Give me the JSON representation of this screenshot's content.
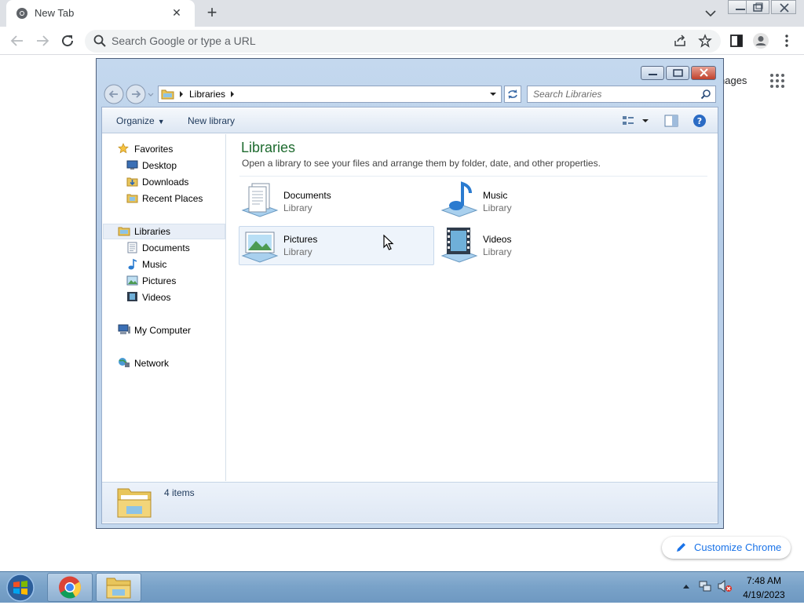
{
  "browser": {
    "tab_title": "New Tab",
    "omnibox_placeholder": "Search Google or type a URL",
    "ntp_images_link": "nages",
    "customize_chrome": "Customize Chrome"
  },
  "explorer": {
    "address_path": "Libraries",
    "search_placeholder": "Search Libraries",
    "toolbar": {
      "organize": "Organize",
      "new_library": "New library"
    },
    "nav": {
      "favorites": "Favorites",
      "favorites_items": [
        "Desktop",
        "Downloads",
        "Recent Places"
      ],
      "libraries": "Libraries",
      "libraries_items": [
        "Documents",
        "Music",
        "Pictures",
        "Videos"
      ],
      "computer": "My Computer",
      "network": "Network"
    },
    "content": {
      "title": "Libraries",
      "subtitle": "Open a library to see your files and arrange them by folder, date, and other properties.",
      "libraries": [
        {
          "name": "Documents",
          "type": "Library"
        },
        {
          "name": "Music",
          "type": "Library"
        },
        {
          "name": "Pictures",
          "type": "Library"
        },
        {
          "name": "Videos",
          "type": "Library"
        }
      ]
    },
    "status": "4 items"
  },
  "taskbar": {
    "time": "7:48 AM",
    "date": "4/19/2023"
  },
  "colors": {
    "library_title": "#1e6b2f",
    "chrome_link": "#1a73e8",
    "taskbar": "#7aa3c9"
  }
}
